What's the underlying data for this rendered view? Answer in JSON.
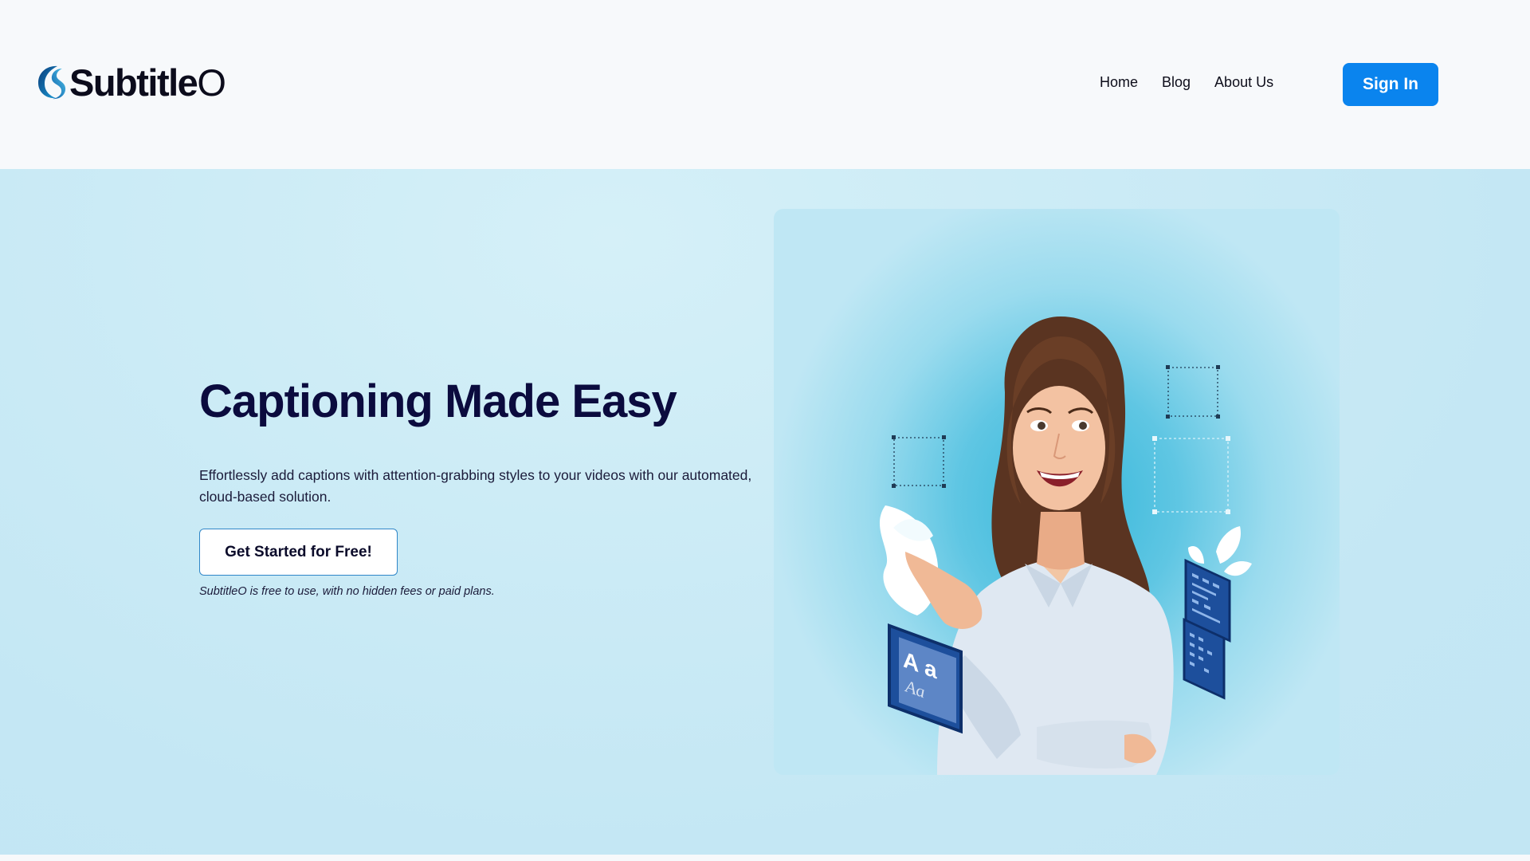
{
  "header": {
    "logo_text": "Subtitle",
    "logo_text_o": "O",
    "nav": [
      "Home",
      "Blog",
      "About Us"
    ],
    "signin_label": "Sign In"
  },
  "hero": {
    "title": "Captioning Made Easy",
    "description": "Effortlessly add captions with attention-grabbing styles to your videos with our automated, cloud-based solution.",
    "cta_label": "Get Started for Free!",
    "note": "SubtitleO is free to use, with no hidden fees or paid plans.",
    "image_caption_glyphs": {
      "upper": "A a",
      "lower": "Aa"
    }
  },
  "colors": {
    "accent": "#0a84ee",
    "title": "#0b0b3e",
    "hero_bg": "#c4e7f4",
    "header_bg": "#f7f9fb"
  },
  "icons": {
    "logo": "subtitleo-logo-icon"
  }
}
